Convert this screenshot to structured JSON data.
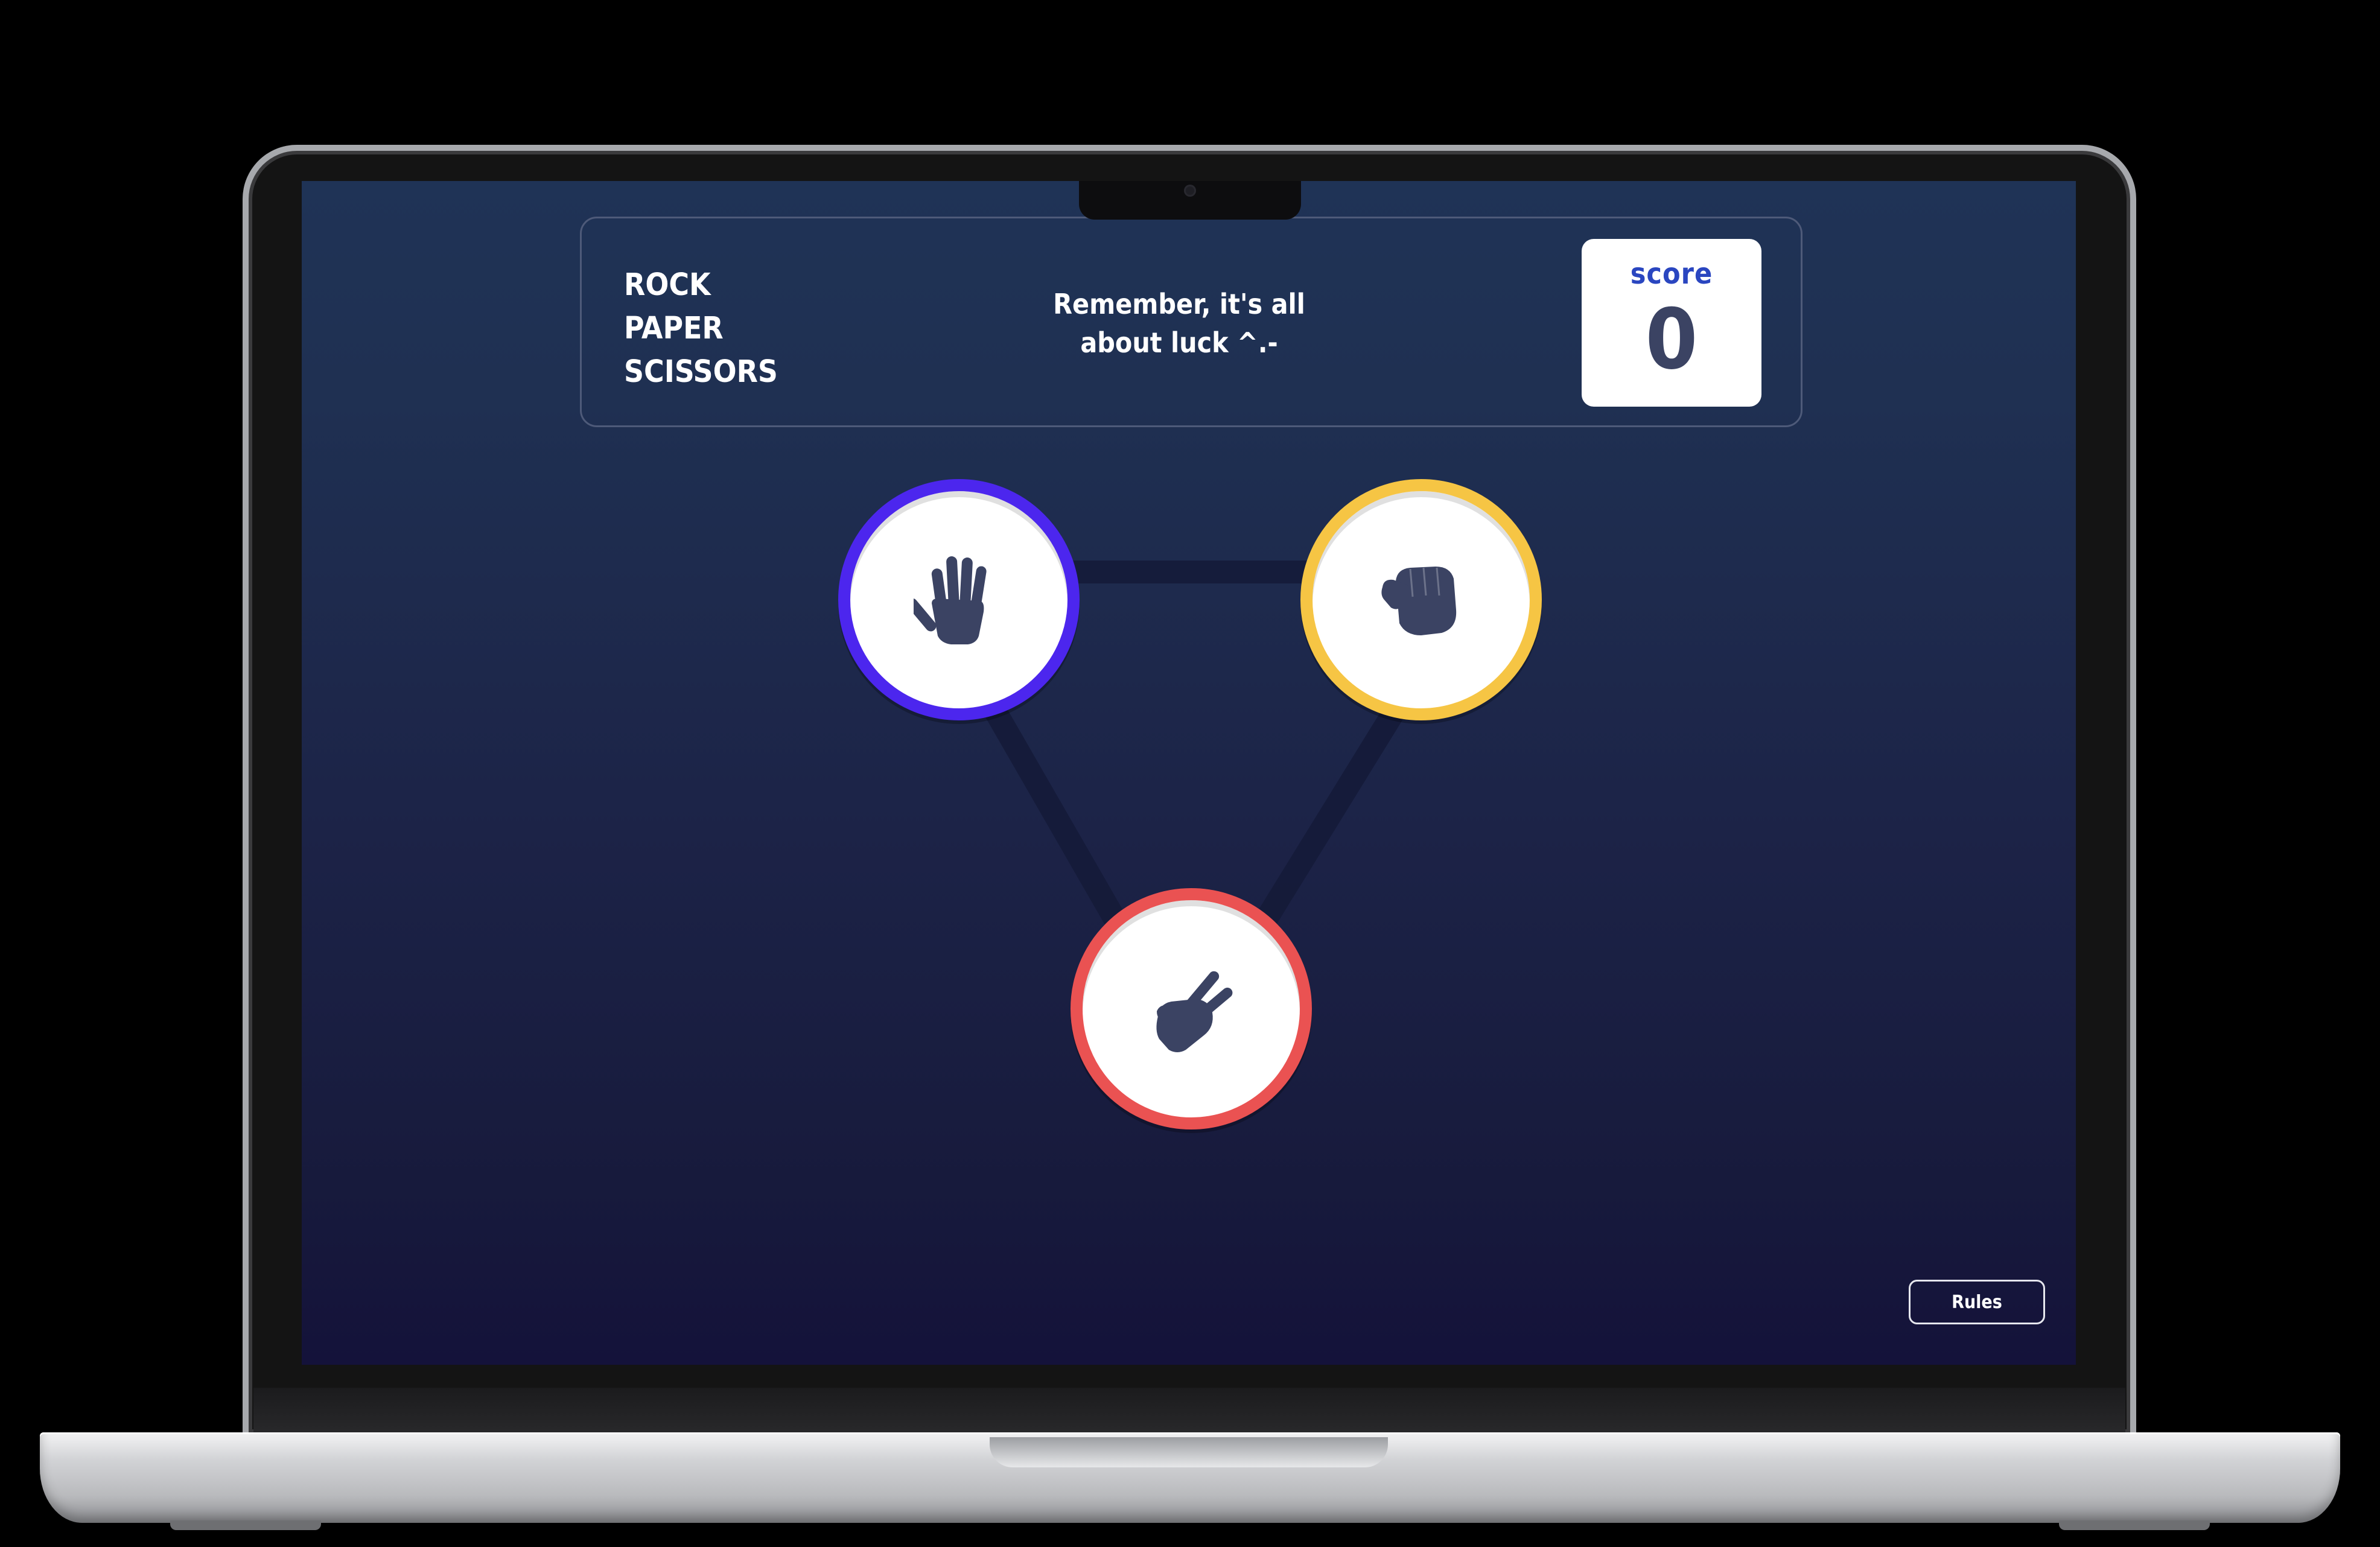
{
  "header": {
    "title_lines": [
      "ROCK",
      "PAPER",
      "SCISSORS"
    ],
    "tagline_lines": [
      "Remember, it's all",
      "about luck ^.-"
    ]
  },
  "score": {
    "label": "score",
    "value": "0"
  },
  "choices": [
    {
      "id": "paper",
      "icon": "paper-hand-icon",
      "ring_color": "#4c26ee"
    },
    {
      "id": "rock",
      "icon": "rock-fist-icon",
      "ring_color": "#f6c544"
    },
    {
      "id": "scissors",
      "icon": "scissors-hand-icon",
      "ring_color": "#ea5252"
    }
  ],
  "rules_button": {
    "label": "Rules"
  },
  "colors": {
    "icon": "#3b4363",
    "score_label": "#2a46c0",
    "background_top": "#1f3356",
    "background_bottom": "#14123a"
  }
}
